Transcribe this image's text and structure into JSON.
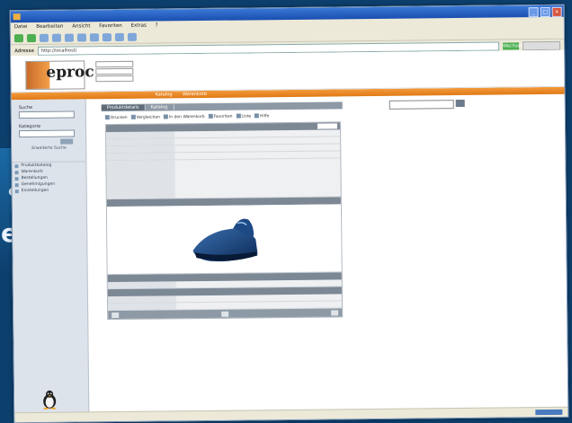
{
  "background": {
    "accent_color": "#0d3f6d",
    "side_glyph_1": "e",
    "side_glyph_2": "e"
  },
  "window": {
    "titlebar_color": "#1a4fb0",
    "win_buttons": {
      "minimize": "_",
      "maximize": "□",
      "close": "×"
    }
  },
  "browser": {
    "menu": [
      "Datei",
      "Bearbeiten",
      "Ansicht",
      "Favoriten",
      "Extras",
      "?"
    ],
    "address_label": "Adresse",
    "address_value": "http://localhost/",
    "go_label": "Wechseln zu"
  },
  "site": {
    "logo_text": "eproc",
    "orange_color": "#e07a16",
    "top_nav": [
      "Katalog",
      "Warenkorb"
    ]
  },
  "sidebar": {
    "search_label": "Suche",
    "search2_label": "Kategorie",
    "link": "Erweiterte Suche",
    "nav_items": [
      "Produktkatalog",
      "Warenkorb",
      "Bestellungen",
      "Genehmigungen",
      "Einstellungen"
    ]
  },
  "content": {
    "tabs": [
      "Produktdetails",
      "Katalog"
    ],
    "actions": [
      "Drucken",
      "Vergleichen",
      "In den Warenkorb",
      "Favoriten",
      "Liste",
      "Hilfe"
    ]
  }
}
